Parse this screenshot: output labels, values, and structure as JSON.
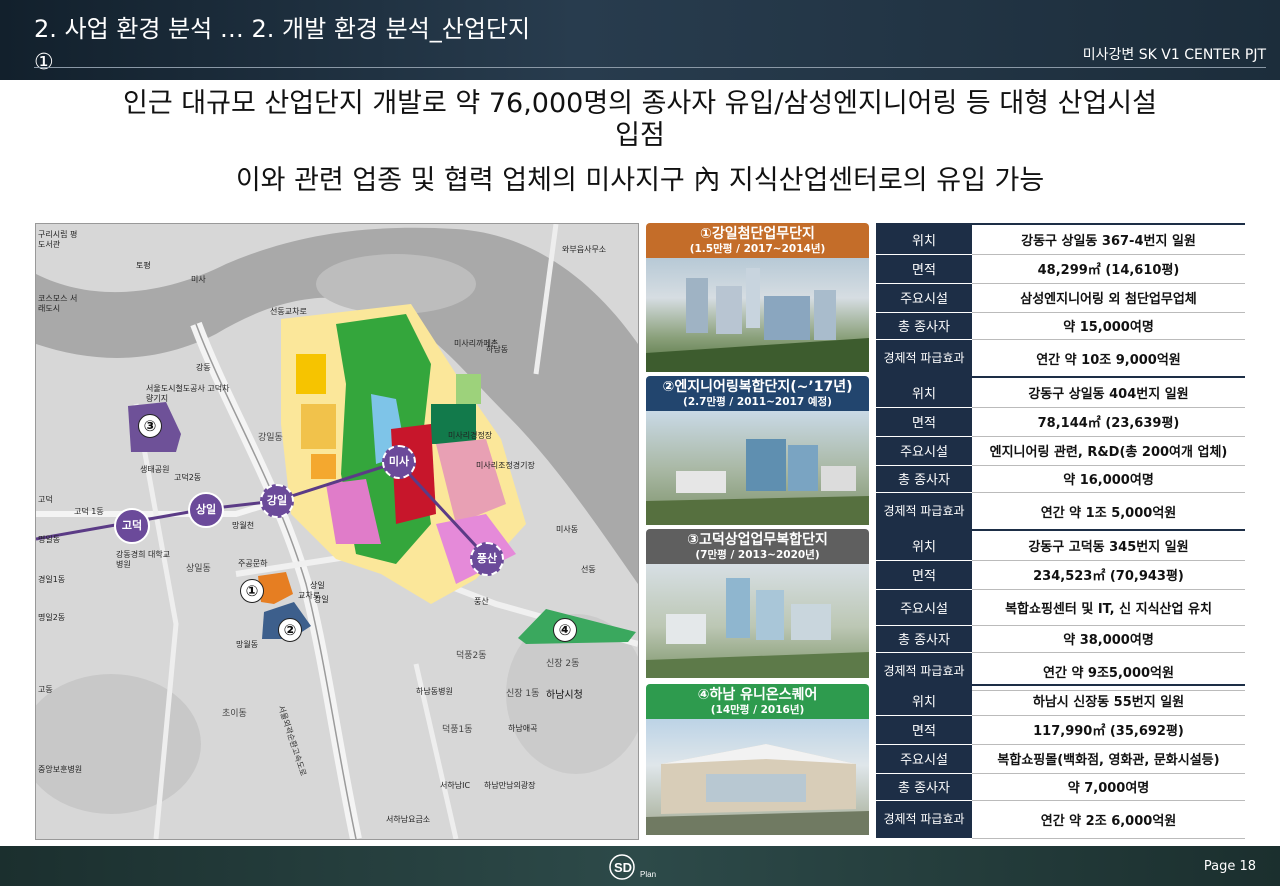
{
  "header": {
    "title_line1": "2. 사업 환경 분석 … 2. 개발 환경 분석_산업단지",
    "title_line2": "①",
    "project": "미사강변 SK V1 CENTER PJT"
  },
  "headline": {
    "line1": "인근 대규모 산업단지 개발로 약 76,000명의 종사자 유입/삼성엔지니어링 등 대형 산업시설",
    "line2": "입점",
    "line3": "이와 관련 업종 및 협력 업체의 미사지구 內 지식산업센터로의 유입 가능"
  },
  "map": {
    "labels": [
      "구리시립 평도서관",
      "토평",
      "와부읍사무소",
      "미사",
      "코스모스 서래도시",
      "서울도시철도공사 고덕차량기지",
      "선동교차로",
      "미사리까페촌",
      "강동",
      "강일동",
      "미사리경정장",
      "미사리조정경기장",
      "망월천",
      "생태공원",
      "고덕 1동",
      "고덕2동",
      "강동경희 대학교병원",
      "상일동",
      "주공문하",
      "교차로",
      "강일",
      "상일",
      "하남동",
      "망월동",
      "미사동",
      "선동",
      "풍산",
      "신장 2동",
      "하남시청",
      "신장 1동",
      "덕풍2동",
      "하남동병원",
      "덕풍1동",
      "초이동",
      "하남애곡",
      "하남만남의광장",
      "서하남IC",
      "서하남요금소",
      "중앙보훈병원",
      "명일동",
      "경일1동",
      "명일2동",
      "고덕",
      "고동"
    ],
    "stations": [
      "고덕",
      "상일",
      "강일",
      "미사",
      "풍산"
    ],
    "markers": [
      "③",
      "①",
      "②",
      "④"
    ],
    "road_label": "서울외곽순환고속도로"
  },
  "complexes": [
    {
      "title": "①강일첨단업무단지",
      "subtitle": "(1.5만평 / 2017~2014년)",
      "color": "#c46d29",
      "rows": [
        {
          "k": "위치",
          "v": "강동구 상일동 367-4번지 일원"
        },
        {
          "k": "면적",
          "v": "48,299㎡ (14,610평)"
        },
        {
          "k": "주요시설",
          "v": "삼성엔지니어링 외 첨단업무업체"
        },
        {
          "k": "총 종사자",
          "v": "약 15,000여명"
        },
        {
          "k": "경제적 파급효과",
          "v": "연간 약 10조 9,000억원"
        }
      ]
    },
    {
      "title": "②엔지니어링복합단지(~’17년)",
      "subtitle": "(2.7만평 / 2011~2017 예정)",
      "color": "#22456e",
      "rows": [
        {
          "k": "위치",
          "v": "강동구 상일동 404번지 일원"
        },
        {
          "k": "면적",
          "v": "78,144㎡ (23,639평)"
        },
        {
          "k": "주요시설",
          "v": "엔지니어링 관련, R&D(총 200여개 업체)"
        },
        {
          "k": "총 종사자",
          "v": "약 16,000여명"
        },
        {
          "k": "경제적 파급효과",
          "v": "연간 약 1조 5,000억원"
        }
      ]
    },
    {
      "title": "③고덕상업업무복합단지",
      "subtitle": "(7만평 / 2013~2020년)",
      "color": "#5f5f5f",
      "rows": [
        {
          "k": "위치",
          "v": "강동구 고덕동 345번지 일원"
        },
        {
          "k": "면적",
          "v": "234,523㎡ (70,943평)"
        },
        {
          "k": "주요시설",
          "v": "복합쇼핑센터 및 IT, 신 지식산업 유치"
        },
        {
          "k": "총 종사자",
          "v": "약 38,000여명"
        },
        {
          "k": "경제적 파급효과",
          "v": "연간 약 9조5,000억원"
        }
      ]
    },
    {
      "title": "④하남 유니온스퀘어",
      "subtitle": "(14만평 / 2016년)",
      "color": "#2e9b4e",
      "rows": [
        {
          "k": "위치",
          "v": "하남시 신장동 55번지 일원"
        },
        {
          "k": "면적",
          "v": "117,990㎡ (35,692평)"
        },
        {
          "k": "주요시설",
          "v": "복합쇼핑몰(백화점, 영화관, 문화시설등)"
        },
        {
          "k": "총 종사자",
          "v": "약 7,000여명"
        },
        {
          "k": "경제적 파급효과",
          "v": "연간 약 2조 6,000억원"
        }
      ]
    }
  ],
  "footer": {
    "logo": "SD Plan",
    "page": "Page 18"
  }
}
